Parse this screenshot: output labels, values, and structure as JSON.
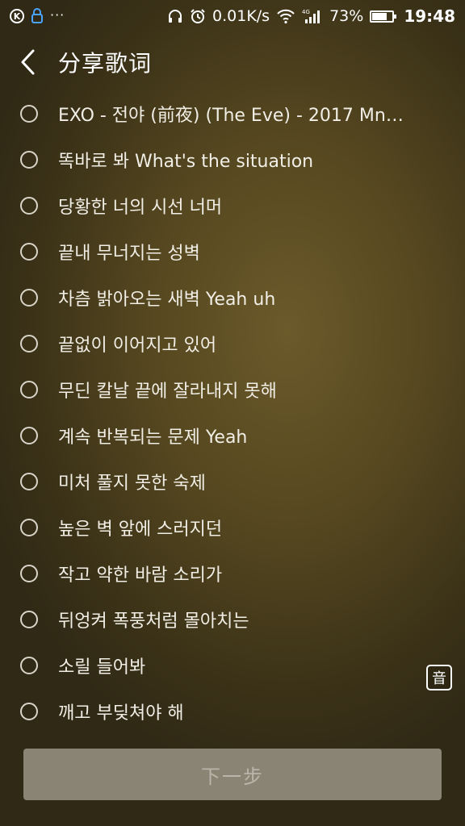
{
  "status_bar": {
    "left_icon_1": "K",
    "dots": "···",
    "network_speed": "0.01K/s",
    "network_type": "4G",
    "battery_percent": "73%",
    "battery_level": 0.73,
    "time": "19:48",
    "icons": [
      "k-circle-icon",
      "lock-icon",
      "headphones-icon",
      "alarm-icon",
      "wifi-icon",
      "signal-icon",
      "battery-icon"
    ]
  },
  "header": {
    "title": "分享歌词",
    "back_icon": "chevron-left-icon"
  },
  "lyrics": [
    {
      "text": "EXO - 전야 (前夜) (The Eve) - 2017 Mnet…"
    },
    {
      "text": "똑바로 봐 What's the situation"
    },
    {
      "text": "당황한 너의 시선 너머"
    },
    {
      "text": "끝내 무너지는 성벽"
    },
    {
      "text": "차츰 밝아오는 새벽 Yeah uh"
    },
    {
      "text": "끝없이 이어지고 있어"
    },
    {
      "text": "무딘 칼날 끝에 잘라내지 못해"
    },
    {
      "text": "계속 반복되는 문제 Yeah"
    },
    {
      "text": "미처 풀지 못한 숙제"
    },
    {
      "text": "높은 벽 앞에 스러지던"
    },
    {
      "text": "작고 약한 바람 소리가"
    },
    {
      "text": "뒤엉켜 폭풍처럼 몰아치는"
    },
    {
      "text": "소릴 들어봐"
    },
    {
      "text": "깨고 부딪쳐야 해"
    }
  ],
  "floating_badge": "音",
  "next_button_label": "下一步"
}
